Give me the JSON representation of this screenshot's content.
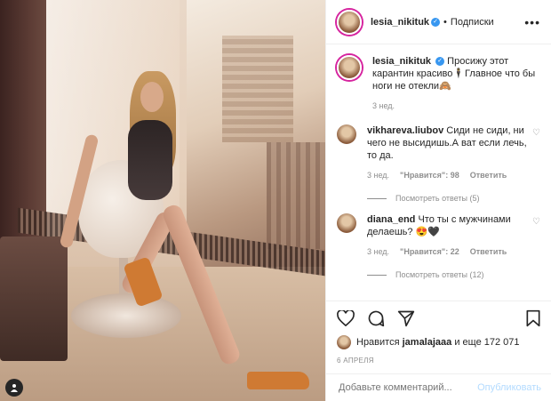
{
  "header": {
    "username": "lesia_nikituk",
    "verified_icon": "verified-icon",
    "separator": "•",
    "follow_label": "Подписки",
    "more_label": "•••"
  },
  "caption": {
    "username": "lesia_nikituk",
    "text": "Просижу этот карантин красиво🕴Главное что бы ноги не отекли🙈",
    "time": "3 нед."
  },
  "comments": [
    {
      "username": "vikhareva.liubov",
      "text": "Сиди не сиди, ни чего не высидишь.А ват если лечь, то да.",
      "time": "3 нед.",
      "likes": "\"Нравится\": 98",
      "reply": "Ответить",
      "replies": "Посмотреть ответы (5)"
    },
    {
      "username": "diana_end",
      "text": "Что ты с мужчинами делаешь? 😍🖤",
      "time": "3 нед.",
      "likes": "\"Нравится\": 22",
      "reply": "Ответить",
      "replies": "Посмотреть ответы (12)"
    }
  ],
  "likes": {
    "prefix": "Нравится",
    "user": "jamalajaaa",
    "suffix": "и еще 172 071"
  },
  "date": "6 АПРЕЛЯ",
  "add_comment": {
    "placeholder": "Добавьте комментарий...",
    "publish": "Опубликовать"
  },
  "colors": {
    "verified": "#3897f0",
    "publish_disabled": "#b3dbff",
    "muted": "#8e8e8e"
  }
}
